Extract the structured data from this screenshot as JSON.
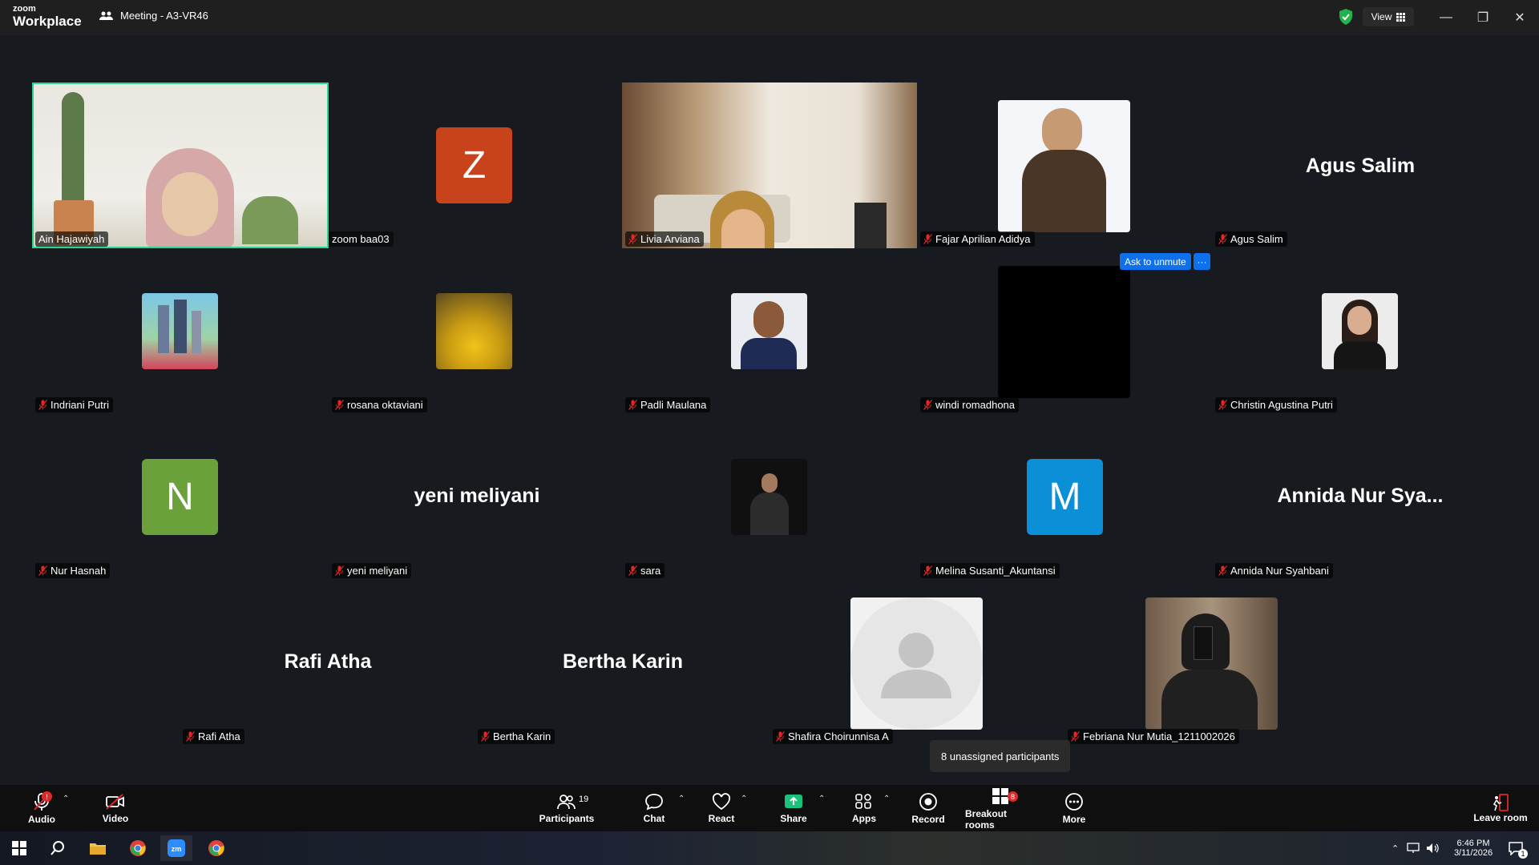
{
  "app": {
    "logo_small": "zoom",
    "logo_big": "Workplace",
    "meeting_title": "Meeting - A3-VR46",
    "view_label": "View"
  },
  "tiles": {
    "t1": {
      "name": "Ain Hajawiyah"
    },
    "t2": {
      "name": "zoom baa03",
      "letter": "Z"
    },
    "t3": {
      "name": "Livia Arviana"
    },
    "t4": {
      "name": "Fajar Aprilian Adidya"
    },
    "t5": {
      "name": "Agus Salim",
      "big": "Agus Salim"
    },
    "t6": {
      "name": "Indriani Putri"
    },
    "t7": {
      "name": "rosana oktaviani"
    },
    "t8": {
      "name": "Padli Maulana"
    },
    "t9": {
      "name": "windi romadhona"
    },
    "t10": {
      "name": "Christin Agustina Putri"
    },
    "t11": {
      "name": "Nur Hasnah",
      "letter": "N"
    },
    "t12": {
      "name": "yeni meliyani",
      "big": "yeni meliyani"
    },
    "t13": {
      "name": "sara"
    },
    "t14": {
      "name": "Melina Susanti_Akuntansi",
      "letter": "M"
    },
    "t15": {
      "name": "Annida Nur Syahbani",
      "big": "Annida Nur Sya..."
    },
    "t16": {
      "name": "Rafi Atha",
      "big": "Rafi Atha"
    },
    "t17": {
      "name": "Bertha Karin",
      "big": "Bertha Karin"
    },
    "t18": {
      "name": "Shafira Choirunnisa A"
    },
    "t19": {
      "name": "Febriana Nur Mutia_1211002026"
    }
  },
  "popup": {
    "ask_unmute": "Ask to unmute",
    "more": "···"
  },
  "tooltip": "8 unassigned participants",
  "toolbar": {
    "audio": "Audio",
    "video": "Video",
    "participants": "Participants",
    "participants_count": "19",
    "chat": "Chat",
    "react": "React",
    "share": "Share",
    "apps": "Apps",
    "record": "Record",
    "breakout": "Breakout rooms",
    "breakout_badge": "8",
    "more": "More",
    "leave": "Leave room"
  },
  "taskbar": {
    "time": "6:46 PM",
    "date": "3/11/2026",
    "notif_count": "1"
  },
  "colors": {
    "active_speaker": "#2dd48c",
    "z_avatar": "#c8421c",
    "n_avatar": "#6ba13a",
    "m_avatar": "#0b8fd6",
    "accent": "#0e71eb",
    "share": "#19c37d"
  }
}
